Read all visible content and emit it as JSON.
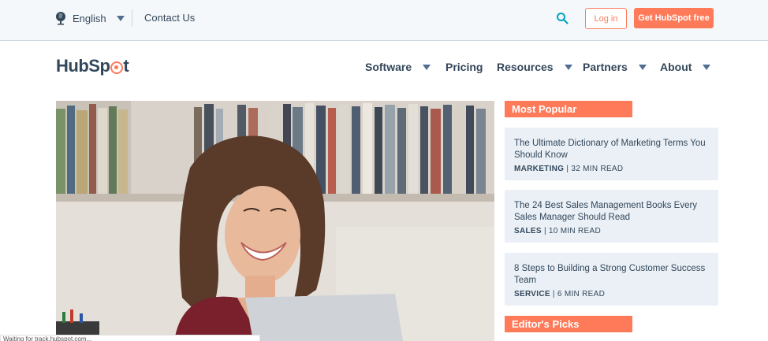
{
  "utility_bar": {
    "language": "English",
    "contact": "Contact Us",
    "login": "Log in",
    "cta": "Get HubSpot free"
  },
  "header": {
    "logo_prefix": "HubSp",
    "logo_suffix": "t",
    "nav": [
      {
        "label": "Software",
        "has_dropdown": true
      },
      {
        "label": "Pricing",
        "has_dropdown": false
      },
      {
        "label": "Resources",
        "has_dropdown": true
      },
      {
        "label": "Partners",
        "has_dropdown": true
      },
      {
        "label": "About",
        "has_dropdown": true
      }
    ]
  },
  "sidebar": {
    "most_popular_label": "Most Popular",
    "editors_picks_label": "Editor's Picks",
    "articles": [
      {
        "title": "The Ultimate Dictionary of Marketing Terms You Should Know",
        "category": "MARKETING",
        "read": "| 32 MIN READ"
      },
      {
        "title": "The 24 Best Sales Management Books Every Sales Manager Should Read",
        "category": "SALES",
        "read": "| 10 MIN READ"
      },
      {
        "title": "8 Steps to Building a Strong Customer Success Team",
        "category": "SERVICE",
        "read": "| 6 MIN READ"
      }
    ]
  },
  "status_bar": {
    "text": "Waiting for track.hubspot.com..."
  },
  "colors": {
    "accent": "#ff7a59",
    "text": "#33475b",
    "card_bg": "#eaf0f6",
    "utility_bg": "#f5f8fa",
    "search_icon": "#00a4bd"
  },
  "icons": [
    "globe-icon",
    "chevron-down-icon",
    "search-icon",
    "sprocket-logo-icon"
  ]
}
